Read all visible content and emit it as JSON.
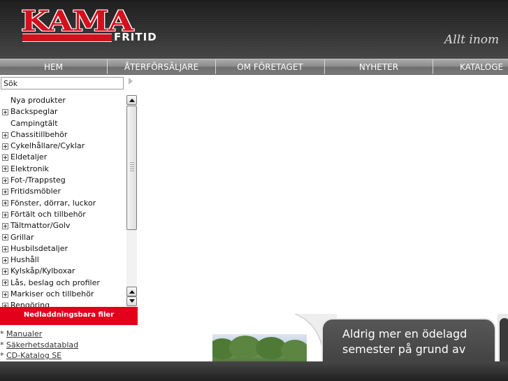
{
  "header": {
    "logo": {
      "main": "KAMA",
      "sub": "FRITID"
    },
    "tagline": "Allt inom"
  },
  "nav": {
    "items": [
      {
        "label": "HEM"
      },
      {
        "label": "ÅTERFÖRSÄLJARE"
      },
      {
        "label": "OM FÖRETAGET"
      },
      {
        "label": "NYHETER"
      },
      {
        "label": "KATALOGE"
      }
    ]
  },
  "search": {
    "value": "Sök",
    "button_icon": "arrow-right-icon"
  },
  "categories": {
    "items": [
      {
        "label": "Nya produkter",
        "expandable": false
      },
      {
        "label": "Backspeglar",
        "expandable": true
      },
      {
        "label": "Campingtält",
        "expandable": false
      },
      {
        "label": "Chassitillbehör",
        "expandable": true
      },
      {
        "label": "Cykelhållare/Cyklar",
        "expandable": true
      },
      {
        "label": "Eldetaljer",
        "expandable": true
      },
      {
        "label": "Elektronik",
        "expandable": true
      },
      {
        "label": "Fot-/Trappsteg",
        "expandable": true
      },
      {
        "label": "Fritidsmöbler",
        "expandable": true
      },
      {
        "label": "Fönster, dörrar, luckor",
        "expandable": true
      },
      {
        "label": "Förtält och tillbehör",
        "expandable": true
      },
      {
        "label": "Tältmattor/Golv",
        "expandable": true
      },
      {
        "label": "Grillar",
        "expandable": true
      },
      {
        "label": "Husbilsdetaljer",
        "expandable": true
      },
      {
        "label": "Hushåll",
        "expandable": true
      },
      {
        "label": "Kylskåp/Kylboxar",
        "expandable": true
      },
      {
        "label": "Lås, beslag och profiler",
        "expandable": true
      },
      {
        "label": "Markiser och tillbehör",
        "expandable": true
      },
      {
        "label": "Rengöring",
        "expandable": true
      }
    ],
    "scroll_position": 0.0
  },
  "downloads": {
    "title": "Nedladdningsbara filer",
    "links": [
      {
        "label": "Manualer"
      },
      {
        "label": "Säkerhetsdatablad"
      },
      {
        "label": "CD-Katalog SE"
      }
    ]
  },
  "banner": {
    "line1": "Aldrig mer en ödelagd",
    "line2": "semester på grund av"
  },
  "colors": {
    "brand_red": "#e2001a",
    "nav_gray": "#8a8a8a",
    "header_dark": "#2a2a2a"
  }
}
